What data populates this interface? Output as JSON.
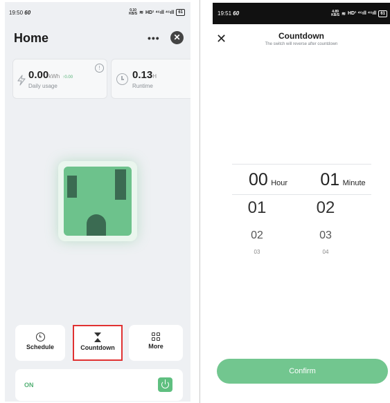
{
  "left_screen": {
    "status_bar": {
      "time": "19:50",
      "extra": "60",
      "speed": "0.10",
      "speed_unit": "KB/S",
      "network": "HD¹ ⁴⁶ıll ⁴⁶ıll",
      "battery": "61"
    },
    "header": {
      "title": "Home",
      "more_label": "•••",
      "close_label": "✕"
    },
    "usage_card": {
      "value": "0.00",
      "unit": "kWh",
      "trend": "↑0.00",
      "label": "Daily usage",
      "info_label": "!"
    },
    "runtime_card": {
      "value": "0.13",
      "unit": "H",
      "label": "Runtime"
    },
    "actions": [
      {
        "label": "Schedule"
      },
      {
        "label": "Countdown"
      },
      {
        "label": "More"
      }
    ],
    "power": {
      "state_label": "ON"
    },
    "colors": {
      "accent": "#5fbf80",
      "highlight_border": "#e03131",
      "socket": "#6dc28c"
    }
  },
  "right_screen": {
    "status_bar": {
      "time": "19:51",
      "extra": "60",
      "speed": "4.89",
      "speed_unit": "KB/S",
      "network": "HD¹ ⁴⁶ıll ⁴⁶ıll",
      "battery": "61"
    },
    "header": {
      "title": "Countdown",
      "subtitle": "The switch will reverse after countdown",
      "close_label": "✕"
    },
    "picker": {
      "hour": {
        "selected": "00",
        "unit": "Hour",
        "next": [
          "01",
          "02",
          "03"
        ]
      },
      "minute": {
        "selected": "01",
        "unit": "Minute",
        "next": [
          "02",
          "03",
          "04"
        ]
      }
    },
    "confirm_label": "Confirm"
  }
}
